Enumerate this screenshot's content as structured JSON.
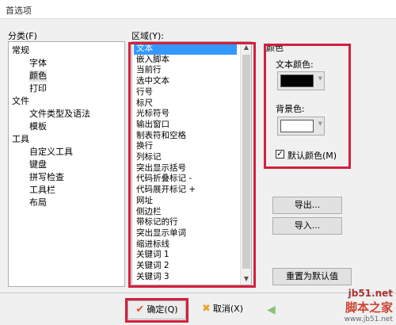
{
  "window": {
    "title": "首选项"
  },
  "category": {
    "label": "分类(F)",
    "items": [
      {
        "label": "常规",
        "level": 0
      },
      {
        "label": "字体",
        "level": 1
      },
      {
        "label": "颜色",
        "level": 1
      },
      {
        "label": "打印",
        "level": 1
      },
      {
        "label": "文件",
        "level": 0
      },
      {
        "label": "文件类型及语法",
        "level": 1
      },
      {
        "label": "模板",
        "level": 1
      },
      {
        "label": "工具",
        "level": 0
      },
      {
        "label": "自定义工具",
        "level": 1
      },
      {
        "label": "键盘",
        "level": 1
      },
      {
        "label": "拼写检查",
        "level": 1
      },
      {
        "label": "工具栏",
        "level": 1
      },
      {
        "label": "布局",
        "level": 1
      }
    ],
    "selected": "颜色"
  },
  "area": {
    "label": "区域(Y):",
    "items": [
      "文本",
      "嵌入脚本",
      "当前行",
      "选中文本",
      "行号",
      "标尺",
      "光标符号",
      "输出窗口",
      "制表符和空格",
      "换行",
      "列标记",
      "突出显示括号",
      "代码折叠标记 -",
      "代码展开标记 +",
      "网址",
      "侧边栏",
      "带标记的行",
      "突出显示单词",
      "缩进标线",
      "关键词 1",
      "关键词 2",
      "关键词 3"
    ],
    "selected": "文本"
  },
  "color": {
    "group_label": "颜色",
    "text_color_label": "文本颜色:",
    "text_color": "#000000",
    "bg_color_label": "背景色:",
    "bg_color": "#ffffff",
    "default_color_label": "默认颜色(M)",
    "default_checked": true
  },
  "buttons": {
    "export": "导出...",
    "import": "导入...",
    "reset": "重置为默认值",
    "ok": "确定(Q)",
    "cancel": "取消(X)"
  },
  "watermark": {
    "site": "jb51.net",
    "name": "脚本之家",
    "url": "www.jb51.net"
  },
  "colors": {
    "highlight_red": "#d4203c",
    "selection_blue": "#3399ff"
  }
}
